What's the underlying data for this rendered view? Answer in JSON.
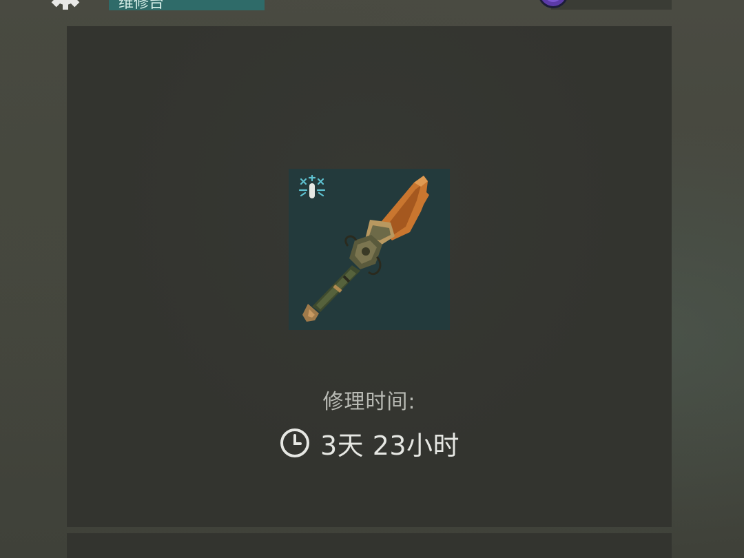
{
  "header": {
    "settings_icon": "gear-icon",
    "tab_label": "维修台",
    "currency_icon": "gem-icon"
  },
  "repair": {
    "item_icon": "weapon-icon",
    "status_icon": "cold-snowflake-icon",
    "time_label": "修理时间:",
    "time_icon": "clock-icon",
    "time_value": "3天 23小时"
  },
  "colors": {
    "tab_bg": "#2f6b69",
    "panel_bg": "#33342f",
    "item_slot_bg": "#233a3c",
    "accent_cold": "#5fc3d2"
  }
}
